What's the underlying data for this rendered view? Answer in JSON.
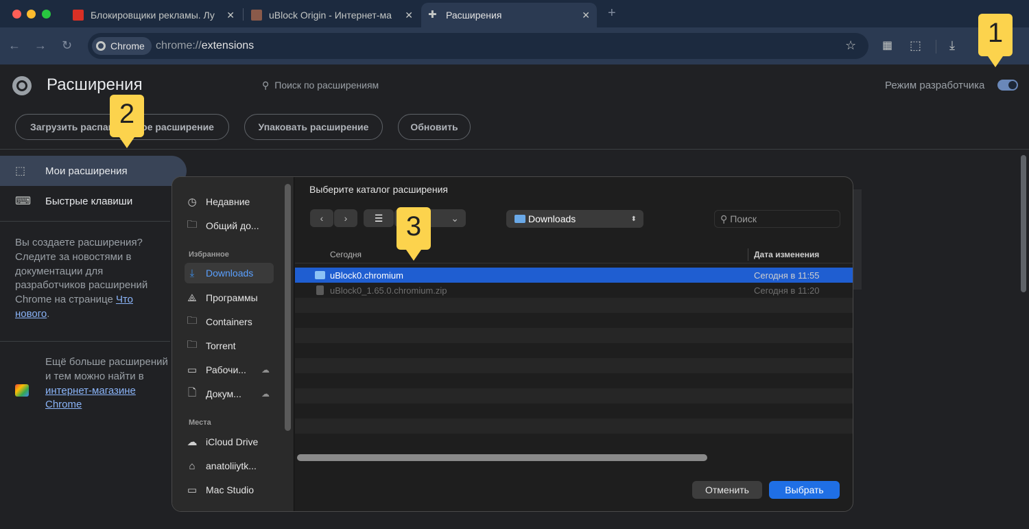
{
  "tabs": [
    {
      "title": "Блокировщики рекламы. Лу",
      "close": "✕"
    },
    {
      "title": "uBlock Origin - Интернет-ма",
      "close": "✕"
    },
    {
      "title": "Расширения",
      "close": "✕"
    }
  ],
  "new_tab": "+",
  "omnibox": {
    "chip": "Chrome",
    "url_scheme": "chrome://",
    "url_path": "extensions"
  },
  "page": {
    "title": "Расширения",
    "search_placeholder": "Поиск по расширениям",
    "dev_mode_label": "Режим разработчика",
    "dev_mode_on": true,
    "buttons": [
      "Загрузить распакованное расширение",
      "Упаковать расширение",
      "Обновить"
    ]
  },
  "sidebar": {
    "items": [
      {
        "label": "Мои расширения",
        "icon": "puzzle-icon",
        "active": true
      },
      {
        "label": "Быстрые клавиши",
        "icon": "keyboard-icon",
        "active": false
      }
    ],
    "dev_text_pre": "Вы создаете расширения? Следите за новостями в документации для разработчиков расширений Chrome на странице ",
    "dev_link": "Что нового",
    "dev_text_post": ".",
    "store_text_pre": "Ещё больше расширений и тем можно найти в ",
    "store_link": "интернет-магазине Chrome"
  },
  "dialog": {
    "title": "Выберите каталог расширения",
    "location": "Downloads",
    "search_placeholder": "Поиск",
    "sidebar": {
      "top": [
        {
          "label": "Недавние",
          "icon": "clock-icon"
        },
        {
          "label": "Общий до...",
          "icon": "shared-folder-icon"
        }
      ],
      "favorites_heading": "Избранное",
      "favorites": [
        {
          "label": "Downloads",
          "icon": "download-icon",
          "selected": true
        },
        {
          "label": "Программы",
          "icon": "applications-icon"
        },
        {
          "label": "Containers",
          "icon": "folder-icon"
        },
        {
          "label": "Torrent",
          "icon": "folder-icon"
        },
        {
          "label": "Рабочи...",
          "icon": "desktop-icon",
          "cloud": true
        },
        {
          "label": "Докум...",
          "icon": "document-icon",
          "cloud": true
        }
      ],
      "places_heading": "Места",
      "places": [
        {
          "label": "iCloud Drive",
          "icon": "cloud-icon"
        },
        {
          "label": "anatoliiytk...",
          "icon": "home-icon"
        },
        {
          "label": "Mac Studio",
          "icon": "computer-icon"
        }
      ]
    },
    "columns": {
      "name": "Сегодня",
      "date": "Дата изменения"
    },
    "files": [
      {
        "name": "uBlock0.chromium",
        "date": "Сегодня в 11:55",
        "selected": true,
        "type": "folder"
      },
      {
        "name": "uBlock0_1.65.0.chromium.zip",
        "date": "Сегодня в 11:20",
        "selected": false,
        "type": "zip"
      }
    ],
    "cancel_label": "Отменить",
    "choose_label": "Выбрать"
  },
  "callouts": [
    "1",
    "2",
    "3"
  ],
  "colors": {
    "accent": "#1f5ed1",
    "callout": "#fcd34d",
    "link": "#8ab4f8"
  }
}
